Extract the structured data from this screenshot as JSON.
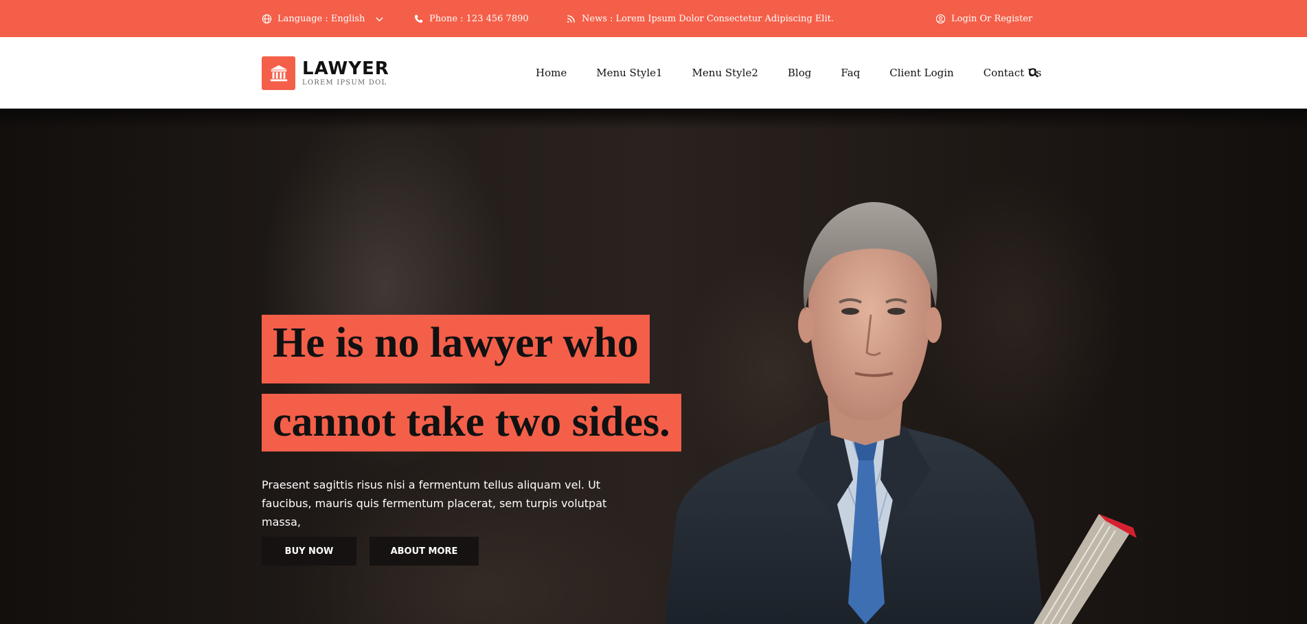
{
  "topbar": {
    "language": "Language : English",
    "phone": "Phone : 123 456 7890",
    "news": "News : Lorem Ipsum Dolor Consectetur Adipiscing Elit.",
    "login": "Login Or Register"
  },
  "logo": {
    "title": "LAWYER",
    "subtitle": "LOREM IPSUM DOL"
  },
  "nav": {
    "items": [
      "Home",
      "Menu Style1",
      "Menu Style2",
      "Blog",
      "Faq",
      "Client Login",
      "Contact Us"
    ]
  },
  "hero": {
    "headline_line1": "He is no lawyer who",
    "headline_line2": "cannot take two sides.",
    "description": "Praesent sagittis risus nisi a fermentum tellus aliquam vel. Ut faucibus, mauris quis fermentum placerat, sem turpis volutpat massa,",
    "buy_label": "BUY NOW",
    "about_label": "ABOUT MORE"
  },
  "colors": {
    "accent": "#f45f49",
    "dark": "#161212",
    "header_bg": "#ffffff"
  }
}
